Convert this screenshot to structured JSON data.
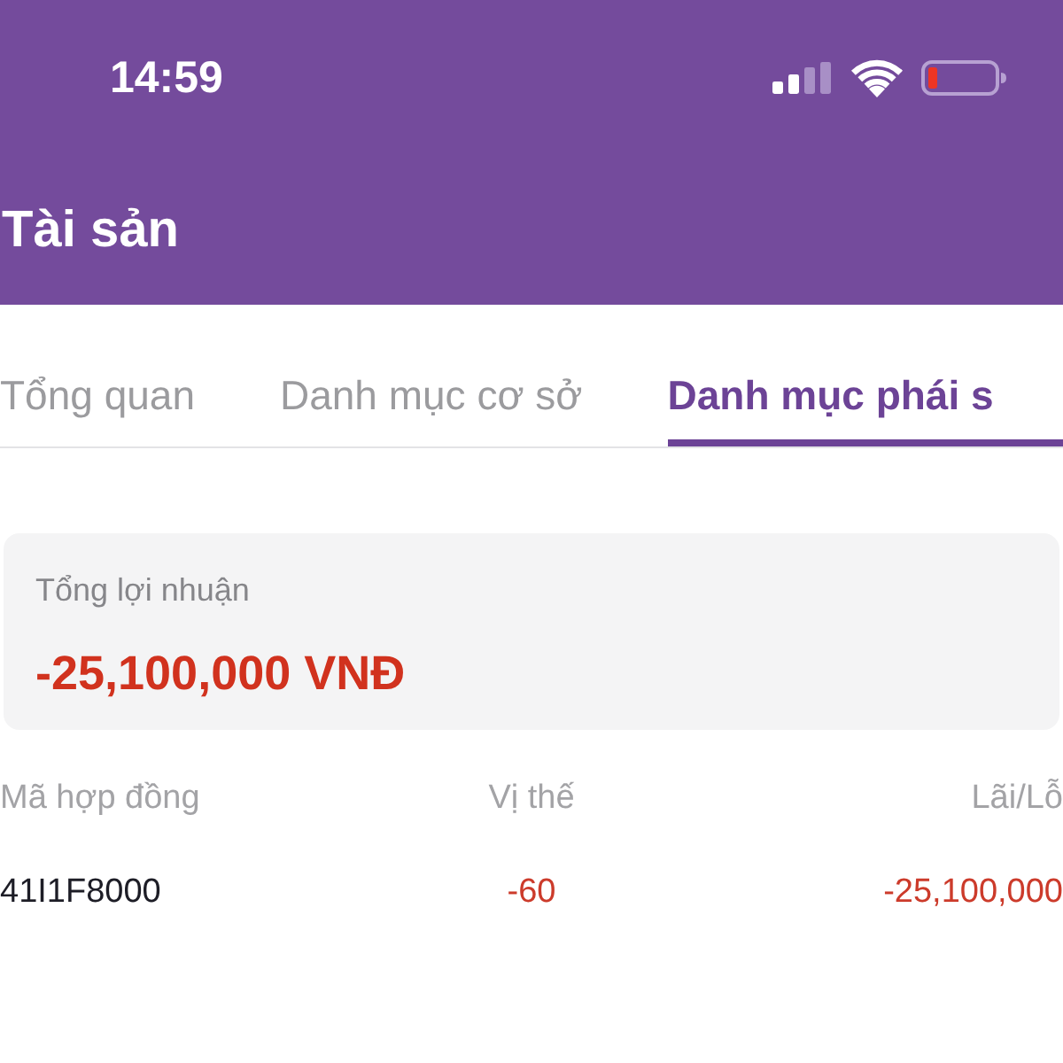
{
  "status_bar": {
    "time": "14:59"
  },
  "header": {
    "title": "Tài sản"
  },
  "tabs": [
    {
      "label": "Tổng quan",
      "selected": false
    },
    {
      "label": "Danh mục cơ sở",
      "selected": false
    },
    {
      "label": "Danh mục phái s",
      "selected": true
    }
  ],
  "summary": {
    "label": "Tổng lợi nhuận",
    "value": "-25,100,000 VNĐ"
  },
  "table": {
    "columns": [
      "Mã hợp đồng",
      "Vị thế",
      "Lãi/Lỗ"
    ],
    "rows": [
      {
        "cells": [
          "41I1F8000",
          "-60",
          "-25,100,000"
        ]
      }
    ]
  }
}
